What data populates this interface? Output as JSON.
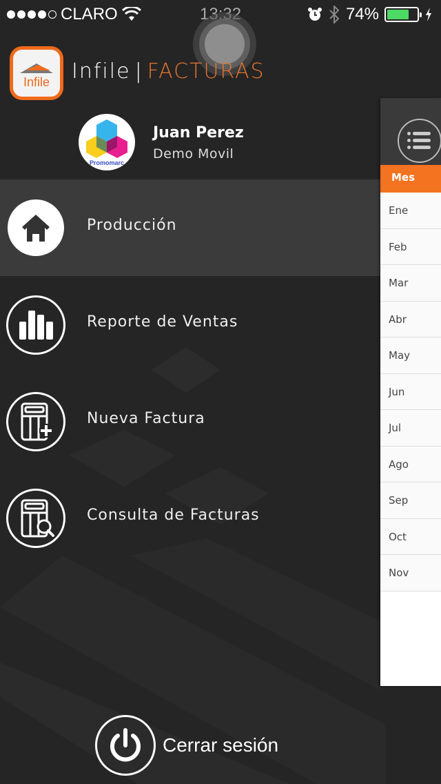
{
  "status_bar": {
    "signal_filled": 4,
    "signal_total": 5,
    "carrier": "CLARO",
    "wifi_icon": "wifi-icon",
    "time": "13:32",
    "alarm_icon": "alarm-icon",
    "bluetooth_icon": "bluetooth-icon",
    "battery_percent": "74%",
    "battery_level": 0.74,
    "charging_icon": "bolt-icon"
  },
  "header": {
    "logo_text": "Infile",
    "brand": "Infile",
    "separator": "|",
    "product": "FACTURAS"
  },
  "user": {
    "avatar_caption": "Promomarc",
    "name": "Juan Perez",
    "company": "Demo Movil"
  },
  "menu": {
    "items": [
      {
        "label": "Producción",
        "icon": "home-icon",
        "active": true
      },
      {
        "label": "Reporte de Ventas",
        "icon": "bar-chart-icon",
        "active": false
      },
      {
        "label": "Nueva Factura",
        "icon": "invoice-add-icon",
        "active": false
      },
      {
        "label": "Consulta de Facturas",
        "icon": "invoice-search-icon",
        "active": false
      }
    ]
  },
  "logout": {
    "label": "Cerrar sesión",
    "icon": "power-icon"
  },
  "panel": {
    "list_icon": "list-icon",
    "column_header": "Mes",
    "months": [
      "Ene",
      "Feb",
      "Mar",
      "Abr",
      "May",
      "Jun",
      "Jul",
      "Ago",
      "Sep",
      "Oct",
      "Nov"
    ]
  },
  "colors": {
    "accent": "#f47320",
    "background": "#252525",
    "battery": "#4cd964"
  }
}
